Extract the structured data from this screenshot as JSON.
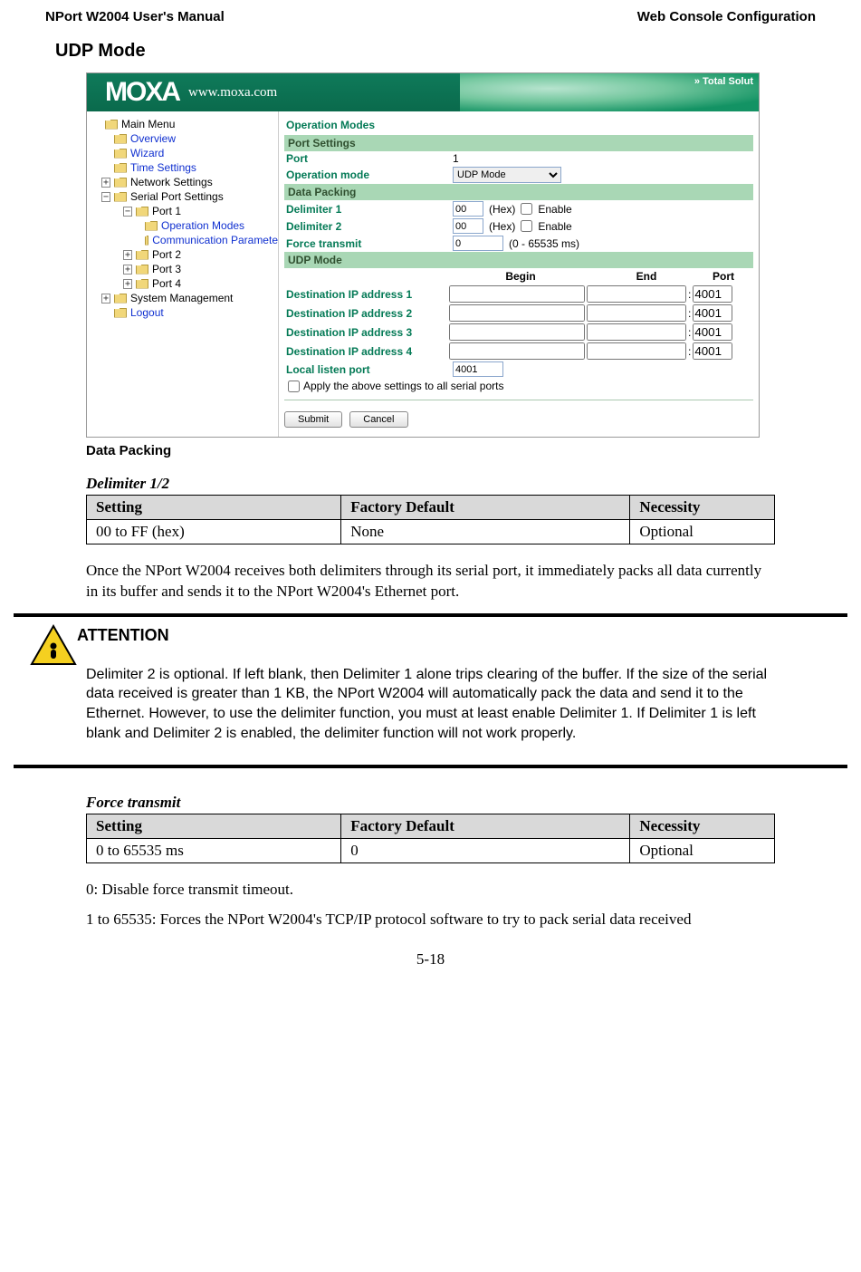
{
  "page": {
    "header_left": "NPort W2004 User's Manual",
    "header_right": "Web Console Configuration",
    "section": "UDP Mode",
    "subsection1": "Data Packing",
    "page_number": "5-18"
  },
  "screenshot": {
    "moxa_url": "www.moxa.com",
    "total_solut": "»  Total Solut",
    "tree": {
      "main_menu": "Main Menu",
      "overview": "Overview",
      "wizard": "Wizard",
      "time": "Time Settings",
      "network": "Network Settings",
      "serial": "Serial Port Settings",
      "port1": "Port 1",
      "opmodes": "Operation Modes",
      "comm": "Communication Paramete",
      "port2": "Port 2",
      "port3": "Port 3",
      "port4": "Port 4",
      "sysmg": "System Management",
      "logout": "Logout"
    },
    "form": {
      "heading": "Operation Modes",
      "band_portsettings": "Port Settings",
      "port_label": "Port",
      "port_value": "1",
      "opmode_label": "Operation mode",
      "opmode_value": "UDP Mode",
      "band_datapack": "Data Packing",
      "delim1_label": "Delimiter 1",
      "delim2_label": "Delimiter 2",
      "delim_value": "00",
      "hex_enable": "(Hex)",
      "enable": "Enable",
      "force_label": "Force transmit",
      "force_value": "0",
      "force_range": "(0 - 65535 ms)",
      "band_udp": "UDP Mode",
      "col_begin": "Begin",
      "col_end": "End",
      "col_port": "Port",
      "dest_prefix": "Destination IP address ",
      "dest_port": "4001",
      "local_listen_label": "Local listen port",
      "local_listen_value": "4001",
      "apply_all": "Apply the above settings to all serial ports",
      "submit": "Submit",
      "cancel": "Cancel"
    }
  },
  "delimiter_table": {
    "title": "Delimiter 1/2",
    "h1": "Setting",
    "h2": "Factory Default",
    "h3": "Necessity",
    "c1": "00 to FF (hex)",
    "c2": "None",
    "c3": "Optional"
  },
  "delimiter_para": "Once the NPort W2004 receives both delimiters through its serial port, it immediately packs all data currently in its buffer and sends it to the NPort W2004's Ethernet port.",
  "attention": {
    "heading": "ATTENTION",
    "body": "Delimiter 2 is optional. If left blank, then Delimiter 1 alone trips clearing of the buffer. If the size of the serial data received is greater than 1 KB, the NPort W2004 will automatically pack the data and send it to the Ethernet. However, to use the delimiter function, you must at least enable Delimiter 1. If Delimiter 1 is left blank and Delimiter 2 is enabled, the delimiter function will not work properly."
  },
  "force_table": {
    "title": "Force transmit",
    "h1": "Setting",
    "h2": "Factory Default",
    "h3": "Necessity",
    "c1": "0 to 65535 ms",
    "c2": "0",
    "c3": "Optional"
  },
  "force_para1": "0: Disable force transmit timeout.",
  "force_para2": "1 to 65535: Forces the NPort W2004's TCP/IP protocol software to try to pack serial data received"
}
